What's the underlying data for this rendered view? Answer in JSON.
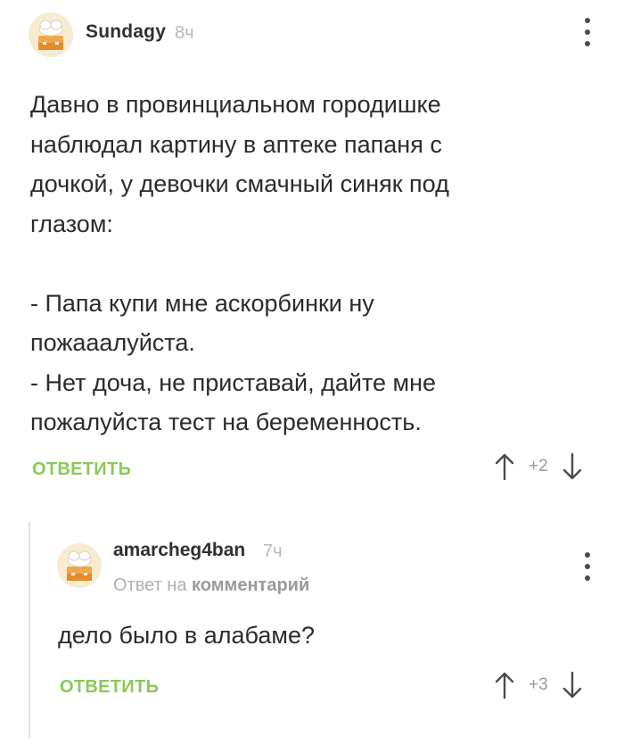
{
  "comments": [
    {
      "username": "Sundagy",
      "time": "8ч",
      "text": "Давно в провинциальном городишке\nнаблюдал картину в аптеке папаня с\nдочкой, у девочки смачный синяк под\nглазом:\n\n- Папа купи мне аскорбинки ну\nпожааалуйста.\n- Нет доча, не приставай, дайте мне\nпожалуйста тест на беременность.",
      "reply_label": "ОТВЕТИТЬ",
      "score": "+2"
    },
    {
      "username": "amarcheg4ban",
      "time": "7ч",
      "reply_to_prefix": "Ответ на",
      "reply_to_link": "комментарий",
      "text": "дело было в алабаме?",
      "reply_label": "ОТВЕТИТЬ",
      "score": "+3"
    }
  ],
  "colors": {
    "accent": "#8ac858",
    "avatar_bg": "#f7ecd2",
    "muted": "#b8b8b8"
  },
  "icons": [
    "avatar-placeholder-icon",
    "more-vertical-icon",
    "arrow-up-icon",
    "arrow-down-icon"
  ]
}
